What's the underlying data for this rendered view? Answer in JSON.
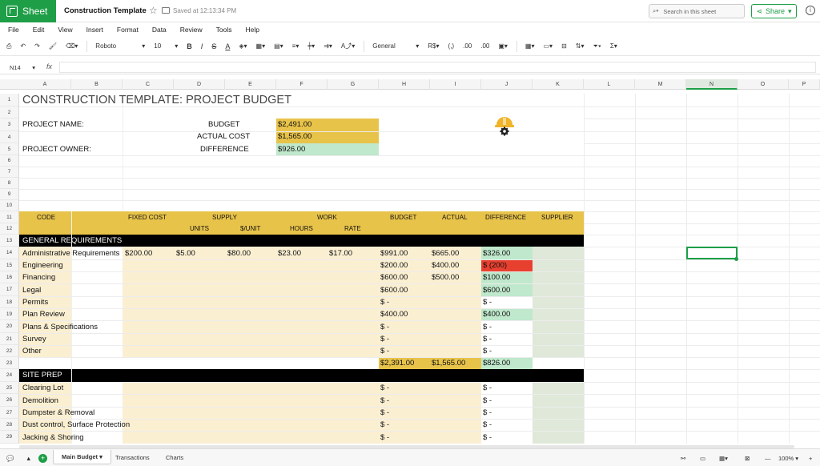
{
  "app": {
    "name": "Sheet",
    "title": "Construction Template",
    "saved": "Saved at 12:13:34 PM"
  },
  "search": {
    "placeholder": "Search in this sheet"
  },
  "share_label": "Share",
  "menu": [
    "File",
    "Edit",
    "View",
    "Insert",
    "Format",
    "Data",
    "Review",
    "Tools",
    "Help"
  ],
  "toolbar": {
    "font": "Roboto",
    "size": "10",
    "bold": "B",
    "italic": "I",
    "strike": "S",
    "underline": "A",
    "number_format": "General",
    "currency": "R$",
    "decimal_dec": ".00",
    "decimal_inc": ".00",
    "comma": "(,)"
  },
  "formula": {
    "cell_ref": "N14",
    "fx": "fx"
  },
  "columns": [
    "A",
    "B",
    "C",
    "D",
    "E",
    "F",
    "G",
    "H",
    "I",
    "J",
    "K",
    "L",
    "M",
    "N",
    "O",
    "P"
  ],
  "active_column": "N",
  "rows": [
    "1",
    "2",
    "3",
    "4",
    "5",
    "6",
    "7",
    "8",
    "9",
    "10",
    "11",
    "12",
    "13",
    "14",
    "15",
    "16",
    "17",
    "18",
    "19",
    "20",
    "21",
    "22",
    "23",
    "24",
    "25",
    "26",
    "27",
    "28",
    "29"
  ],
  "cells": {
    "title": "CONSTRUCTION TEMPLATE: PROJECT BUDGET",
    "project_name_label": "PROJECT NAME:",
    "project_owner_label": "PROJECT OWNER:",
    "budget_label": "BUDGET",
    "actual_cost_label": "ACTUAL COST",
    "difference_label": "DIFFERENCE",
    "budget_value": "$2,491.00",
    "actual_cost_value": "$1,565.00",
    "difference_value": "$926.00",
    "hdr_code": "CODE",
    "hdr_fixed_cost": "FIXED COST",
    "hdr_supply": "SUPPLY",
    "hdr_work": "WORK",
    "hdr_budget": "BUDGET",
    "hdr_actual": "ACTUAL",
    "hdr_difference": "DIFFERENCE",
    "hdr_supplier": "SUPPLIER",
    "hdr_units": "UNITS",
    "hdr_per_unit": "$/UNIT",
    "hdr_hours": "HOURS",
    "hdr_rate": "RATE",
    "section_general": "GENERAL REQUIREMENTS",
    "section_site": "SITE PREP",
    "admin": {
      "name": "Administrative Requirements",
      "fixed": "$200.00",
      "units": "$5.00",
      "per_unit": "$80.00",
      "hours": "$23.00",
      "rate": "$17.00",
      "budget": "$991.00",
      "actual": "$665.00",
      "diff": "$326.00"
    },
    "engineering": {
      "name": "Engineering",
      "budget": "$200.00",
      "actual": "$400.00",
      "diff": "$ (200)"
    },
    "financing": {
      "name": "Financing",
      "budget": "$600.00",
      "actual": "$500.00",
      "diff": "$100.00"
    },
    "legal": {
      "name": "Legal",
      "budget": "$600.00",
      "diff": "$600.00"
    },
    "permits": {
      "name": "Permits",
      "budget": "$ -",
      "diff": "$ -"
    },
    "plan_review": {
      "name": "Plan Review",
      "budget": "$400.00",
      "diff": "$400.00"
    },
    "plans_specs": {
      "name": "Plans & Specifications",
      "budget": "$ -",
      "diff": "$ -"
    },
    "survey": {
      "name": "Survey",
      "budget": "$ -",
      "diff": "$ -"
    },
    "other": {
      "name": "Other",
      "budget": "$ -",
      "diff": "$ -"
    },
    "total_general": {
      "budget": "$2,391.00",
      "actual": "$1,565.00",
      "diff": "$826.00"
    },
    "clearing_lot": {
      "name": "Clearing Lot",
      "budget": "$ -",
      "diff": "$ -"
    },
    "demolition": {
      "name": "Demolition",
      "budget": "$ -",
      "diff": "$ -"
    },
    "dumpster": {
      "name": "Dumpster & Removal",
      "budget": "$ -",
      "diff": "$ -"
    },
    "dust": {
      "name": "Dust control, Surface Protection",
      "budget": "$ -",
      "diff": "$ -"
    },
    "jacking": {
      "name": "Jacking & Shoring",
      "budget": "$ -",
      "diff": "$ -"
    }
  },
  "sheets": [
    {
      "label": "Main Budget"
    },
    {
      "label": "Transactions"
    },
    {
      "label": "Charts"
    }
  ],
  "zoom": "100%",
  "colors": {
    "brand": "#1e9e47",
    "gold": "#e8c34a",
    "cream": "#fbefd2",
    "green_light": "#bfe8cc",
    "red": "#e8402f",
    "black": "#000000",
    "supplier_green": "#dfe8d9"
  }
}
